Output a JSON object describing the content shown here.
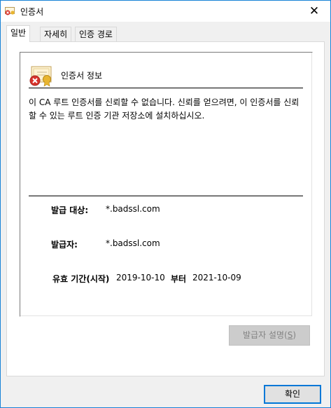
{
  "window": {
    "title": "인증서",
    "close_glyph": "✕"
  },
  "tabs": [
    {
      "label": "일반",
      "active": true
    },
    {
      "label": "자세히",
      "active": false
    },
    {
      "label": "인증 경로",
      "active": false
    }
  ],
  "certificate": {
    "header": "인증서 정보",
    "warning": "이 CA 루트 인증서를 신뢰할 수 없습니다. 신뢰를 얻으려면, 이 인증서를 신뢰할 수 있는 루트 인증 기관 저장소에 설치하십시오.",
    "issued_to_label": "발급 대상:",
    "issued_to_value": "*.badssl.com",
    "issued_by_label": "발급자:",
    "issued_by_value": "*.badssl.com",
    "validity_label": "유효 기간(시작)",
    "valid_from": "2019-10-10",
    "to_label": "부터",
    "valid_to": "2021-10-09"
  },
  "buttons": {
    "issuer_statement_label": "발급자 설명(",
    "issuer_statement_key": "S",
    "issuer_statement_suffix": ")",
    "ok_label": "확인"
  },
  "colors": {
    "accent": "#0078d7",
    "error_red": "#d8322b"
  }
}
